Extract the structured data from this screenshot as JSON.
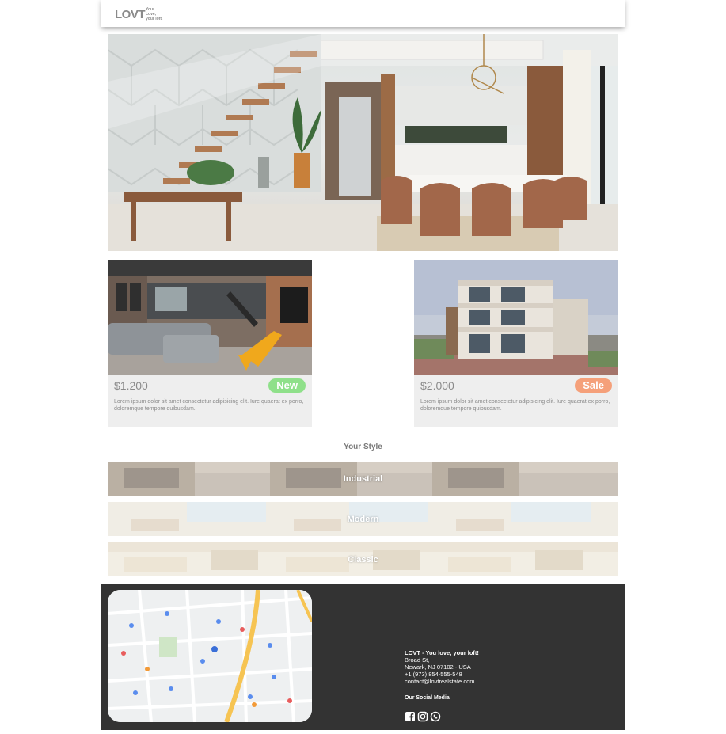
{
  "header": {
    "logo_mark": "LOVT",
    "logo_tagline": "Your Love, your loft."
  },
  "listings": [
    {
      "price": "$1.200",
      "badge": "New",
      "badge_color": "#8fe08a",
      "description": "Lorem ipsum dolor sit amet consectetur adipisicing elit. Iure quaerat ex porro, doloremque tempore quibusdam."
    },
    {
      "price": "$2.000",
      "badge": "Sale",
      "badge_color": "#f5a07a",
      "description": "Lorem ipsum dolor sit amet consectetur adipisicing elit. Iure quaerat ex porro, doloremque tempore quibusdam."
    }
  ],
  "styles": {
    "title": "Your Style",
    "items": [
      {
        "label": "Industrial"
      },
      {
        "label": "Modern"
      },
      {
        "label": "Classic"
      }
    ]
  },
  "footer": {
    "company": "LOVT - You love, your loft!",
    "street": "Broad St,",
    "city": "Newark, NJ 07102 - USA",
    "phone": "+1 (973) 854-555-548",
    "email": "contact@lovtrealstate.com",
    "social_title": "Our Social Media",
    "social_icons": [
      "facebook-icon",
      "instagram-icon",
      "whatsapp-icon"
    ]
  },
  "colors": {
    "footer_bg": "#333333",
    "card_bg": "#eeeeee",
    "new_badge": "#8fe08a",
    "sale_badge": "#f5a07a"
  }
}
